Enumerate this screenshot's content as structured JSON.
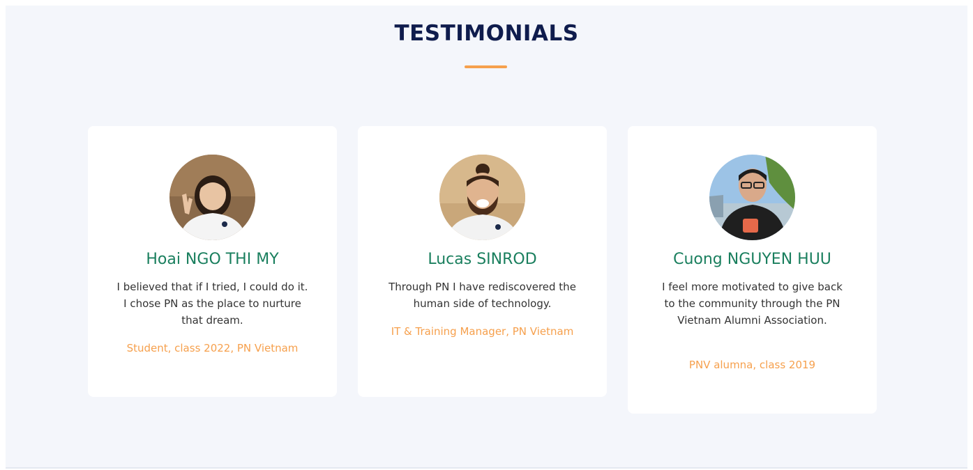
{
  "section": {
    "title": "TESTIMONIALS"
  },
  "colors": {
    "heading": "#0f1c4d",
    "accent": "#f6a04d",
    "name": "#1a7f5e",
    "background": "#f4f6fb"
  },
  "testimonials": [
    {
      "name": "Hoai NGO THI MY",
      "quote": "I believed that if I tried, I could do it. I chose PN as the place to nurture that dream.",
      "role": "Student, class 2022, PN Vietnam",
      "photo_icon": "student-portrait"
    },
    {
      "name": "Lucas SINROD",
      "quote": "Through PN I have rediscovered the human side of technology.",
      "role": "IT & Training Manager, PN Vietnam",
      "photo_icon": "manager-portrait"
    },
    {
      "name": "Cuong NGUYEN HUU",
      "quote": "I feel more motivated to give back to the community through the PN Vietnam Alumni Association.",
      "role": "PNV alumna, class 2019",
      "photo_icon": "alumni-portrait"
    }
  ]
}
